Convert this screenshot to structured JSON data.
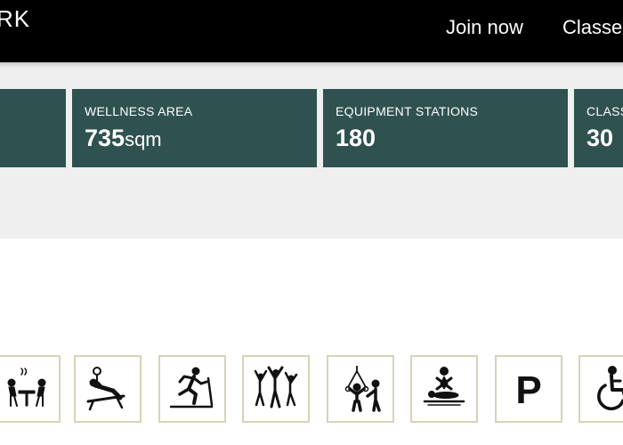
{
  "header": {
    "brand": "RK",
    "nav": [
      {
        "label": "Join now"
      },
      {
        "label": "Classes"
      }
    ]
  },
  "stats": [
    {
      "label": "",
      "value": "",
      "unit": ""
    },
    {
      "label": "WELLNESS AREA",
      "value": "735",
      "unit": "sqm"
    },
    {
      "label": "EQUIPMENT STATIONS",
      "value": "180",
      "unit": ""
    },
    {
      "label": "CLASSES",
      "value": "30",
      "unit": ""
    }
  ],
  "amenities": [
    {
      "icon": "cafe-seating-icon"
    },
    {
      "icon": "bench-press-icon"
    },
    {
      "icon": "treadmill-icon"
    },
    {
      "icon": "group-class-icon"
    },
    {
      "icon": "suspension-training-icon"
    },
    {
      "icon": "massage-icon"
    },
    {
      "icon": "parking-icon",
      "glyph": "P"
    },
    {
      "icon": "accessibility-icon"
    }
  ],
  "colors": {
    "header_bg": "#000000",
    "stats_band_bg": "#efefef",
    "stat_card_bg": "#2f5251",
    "amenity_border": "#d8d2b8"
  }
}
